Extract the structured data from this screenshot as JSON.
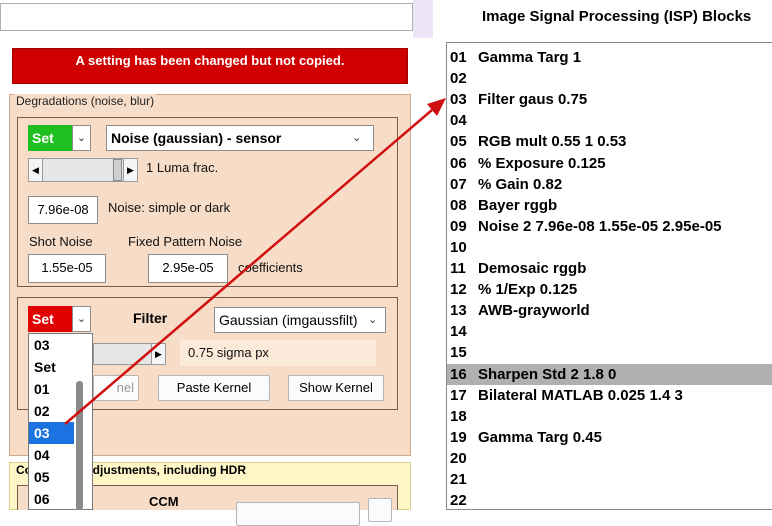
{
  "top": {
    "input_value": ""
  },
  "warning": "A setting has been changed but not copied.",
  "degradations": {
    "title": "Degradations (noise, blur)",
    "noise": {
      "mode": "Set",
      "type": "Noise (gaussian) - sensor",
      "slider_label": "1 Luma frac.",
      "read_noise": "7.96e-08",
      "read_noise_label": "Noise: simple or dark",
      "shot_noise_label": "Shot Noise",
      "fixed_pattern_label": "Fixed Pattern Noise",
      "shot_noise": "1.55e-05",
      "fixed_pattern": "2.95e-05",
      "coeff_label": "coefficients"
    },
    "filter": {
      "mode": "Set",
      "label": "Filter",
      "type": "Gaussian (imgaussfilt)",
      "sigma_label": "0.75  sigma px",
      "copy_kernel": "Copy Kernel",
      "paste_kernel": "Paste Kernel",
      "show_kernel": "Show Kernel"
    },
    "dropdown_list": [
      "03",
      "Set",
      "01",
      "02",
      "03",
      "04",
      "05",
      "06"
    ],
    "dropdown_selected_index": 4
  },
  "lower_panel": {
    "title": "Color / tone adjustments, including HDR",
    "ccm_label": "CCM"
  },
  "isp": {
    "title": "Image Signal Processing (ISP) Blocks",
    "highlighted_index": 15,
    "rows": [
      {
        "num": "01",
        "text": "Gamma Targ 1"
      },
      {
        "num": "02",
        "text": ""
      },
      {
        "num": "03",
        "text": "Filter gaus 0.75"
      },
      {
        "num": "04",
        "text": ""
      },
      {
        "num": "05",
        "text": "RGB mult 0.55 1 0.53"
      },
      {
        "num": "06",
        "text": "% Exposure 0.125"
      },
      {
        "num": "07",
        "text": "% Gain 0.82"
      },
      {
        "num": "08",
        "text": "Bayer rggb"
      },
      {
        "num": "09",
        "text": "Noise 2 7.96e-08 1.55e-05  2.95e-05"
      },
      {
        "num": "10",
        "text": ""
      },
      {
        "num": "11",
        "text": "Demosaic rggb"
      },
      {
        "num": "12",
        "text": "% 1/Exp 0.125"
      },
      {
        "num": "13",
        "text": "AWB-grayworld"
      },
      {
        "num": "14",
        "text": ""
      },
      {
        "num": "15",
        "text": ""
      },
      {
        "num": "16",
        "text": "Sharpen Std 2 1.8 0"
      },
      {
        "num": "17",
        "text": "Bilateral MATLAB 0.025 1.4 3"
      },
      {
        "num": "18",
        "text": ""
      },
      {
        "num": "19",
        "text": "Gamma Targ 0.45"
      },
      {
        "num": "20",
        "text": ""
      },
      {
        "num": "21",
        "text": ""
      },
      {
        "num": "22",
        "text": ""
      }
    ]
  },
  "colors": {
    "warning": "#d10000",
    "set_green": "#1fbf1f",
    "set_red": "#e00000",
    "arrow": "#d01010",
    "selection": "#1a73e0"
  }
}
